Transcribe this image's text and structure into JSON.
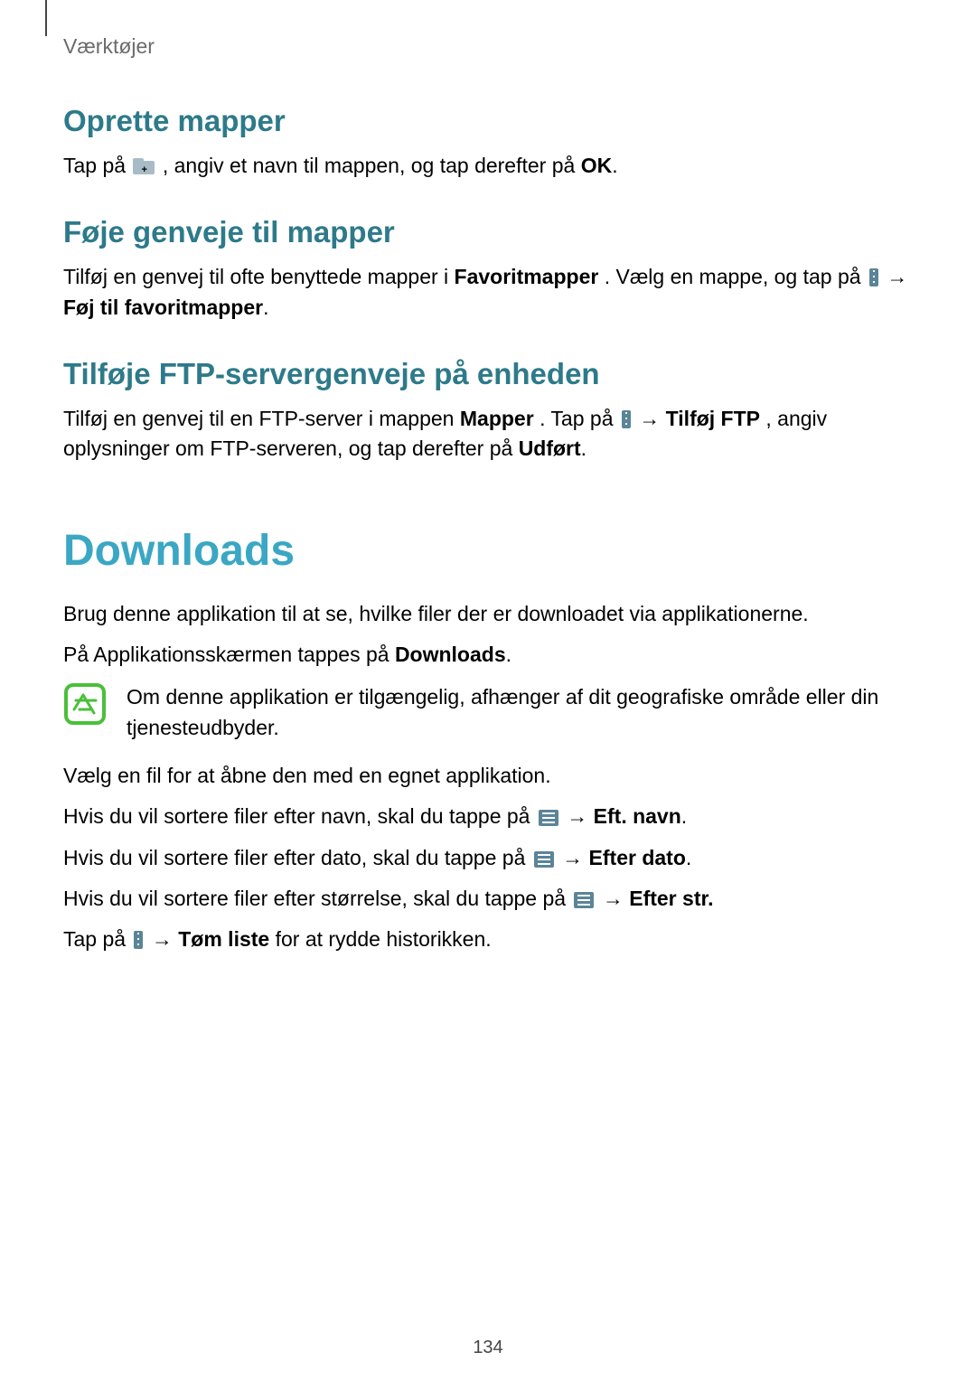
{
  "breadcrumb": "Værktøjer",
  "h_create": "Oprette mapper",
  "p_create_1": "Tap på ",
  "p_create_2": ", angiv et navn til mappen, og tap derefter på ",
  "ok": "OK",
  "period": ".",
  "h_shortcut": "Føje genveje til mapper",
  "p_shortcut_1": "Tilføj en genvej til ofte benyttede mapper i ",
  "favoritmapper": "Favoritmapper",
  "p_shortcut_2": ". Vælg en mappe, og tap på ",
  "arrow": " → ",
  "foj_til_fav": "Føj til favoritmapper",
  "h_ftp": "Tilføje FTP-servergenveje på enheden",
  "p_ftp_1": "Tilføj en genvej til en FTP-server i mappen ",
  "mapper": "Mapper",
  "p_ftp_2": ". Tap på ",
  "tilfoj_ftp": "Tilføj FTP",
  "p_ftp_3": ", angiv oplysninger om FTP-serveren, og tap derefter på ",
  "udfort": "Udført",
  "h_downloads": "Downloads",
  "p_dl_1": "Brug denne applikation til at se, hvilke filer der er downloadet via applikationerne.",
  "p_dl_2a": "På Applikationsskærmen tappes på ",
  "downloads_label": "Downloads",
  "note": "Om denne applikation er tilgængelig, afhænger af dit geografiske område eller din tjenesteudbyder.",
  "p_dl_3": "Vælg en fil for at åbne den med en egnet applikation.",
  "p_sort_name_1": "Hvis du vil sortere filer efter navn, skal du tappe på ",
  "eft_navn": "Eft. navn",
  "p_sort_date_1": "Hvis du vil sortere filer efter dato, skal du tappe på ",
  "efter_dato": "Efter dato",
  "p_sort_size_1": "Hvis du vil sortere filer efter størrelse, skal du tappe på ",
  "efter_str": "Efter str.",
  "p_clear_1": "Tap på ",
  "tom_liste": "Tøm liste",
  "p_clear_2": " for at rydde historikken.",
  "page_number": "134"
}
